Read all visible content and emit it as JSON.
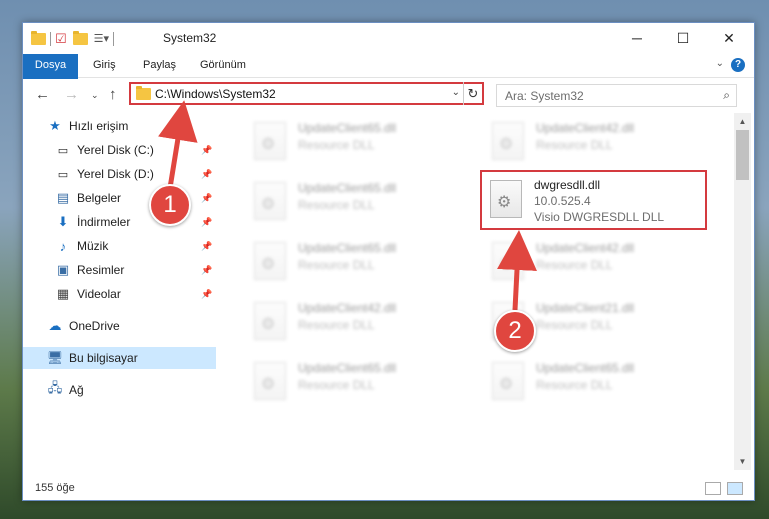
{
  "window": {
    "title": "System32"
  },
  "ribbon": {
    "tabs": [
      "Dosya",
      "Giriş",
      "Paylaş",
      "Görünüm"
    ],
    "help_glyph": "?"
  },
  "address": {
    "path": "C:\\Windows\\System32"
  },
  "search": {
    "placeholder": "Ara: System32"
  },
  "sidebar": {
    "items": [
      {
        "label": "Hızlı erişim",
        "icon": "star-icon"
      },
      {
        "label": "Yerel Disk (C:)",
        "icon": "drive-icon",
        "pinned": true
      },
      {
        "label": "Yerel Disk (D:)",
        "icon": "drive-icon",
        "pinned": true
      },
      {
        "label": "Belgeler",
        "icon": "documents-icon",
        "pinned": true
      },
      {
        "label": "İndirmeler",
        "icon": "download-icon",
        "pinned": true
      },
      {
        "label": "Müzik",
        "icon": "music-icon",
        "pinned": true
      },
      {
        "label": "Resimler",
        "icon": "pictures-icon",
        "pinned": true
      },
      {
        "label": "Videolar",
        "icon": "videos-icon",
        "pinned": true
      },
      {
        "label": "OneDrive",
        "icon": "cloud-icon"
      },
      {
        "label": "Bu bilgisayar",
        "icon": "computer-icon",
        "selected": true
      },
      {
        "label": "Ağ",
        "icon": "network-icon"
      }
    ]
  },
  "files": [
    {
      "name": "UpdateClient65.dll",
      "type": "Resource DLL"
    },
    {
      "name": "UpdateClient42.dll",
      "type": "Resource DLL"
    },
    {
      "name": "UpdateClient65.dll",
      "type": "Resource DLL"
    },
    {
      "name": "dwgresdll.dll",
      "version": "10.0.525.4",
      "type": "Visio DWGRESDLL DLL",
      "highlighted": true
    },
    {
      "name": "UpdateClient65.dll",
      "type": "Resource DLL"
    },
    {
      "name": "UpdateClient42.dll",
      "type": "Resource DLL"
    },
    {
      "name": "UpdateClient42.dll",
      "type": "Resource DLL"
    },
    {
      "name": "UpdateClient21.dll",
      "type": "Resource DLL"
    },
    {
      "name": "UpdateClient65.dll",
      "type": "Resource DLL"
    },
    {
      "name": "UpdateClient65.dll",
      "type": "Resource DLL"
    }
  ],
  "status": {
    "count": "155 öğe"
  },
  "annotations": {
    "badge1": "1",
    "badge2": "2",
    "color": "#e0463f"
  },
  "colors": {
    "accent": "#1a6fc1",
    "highlight_border": "#d43a3f",
    "selected": "#cce8ff"
  }
}
